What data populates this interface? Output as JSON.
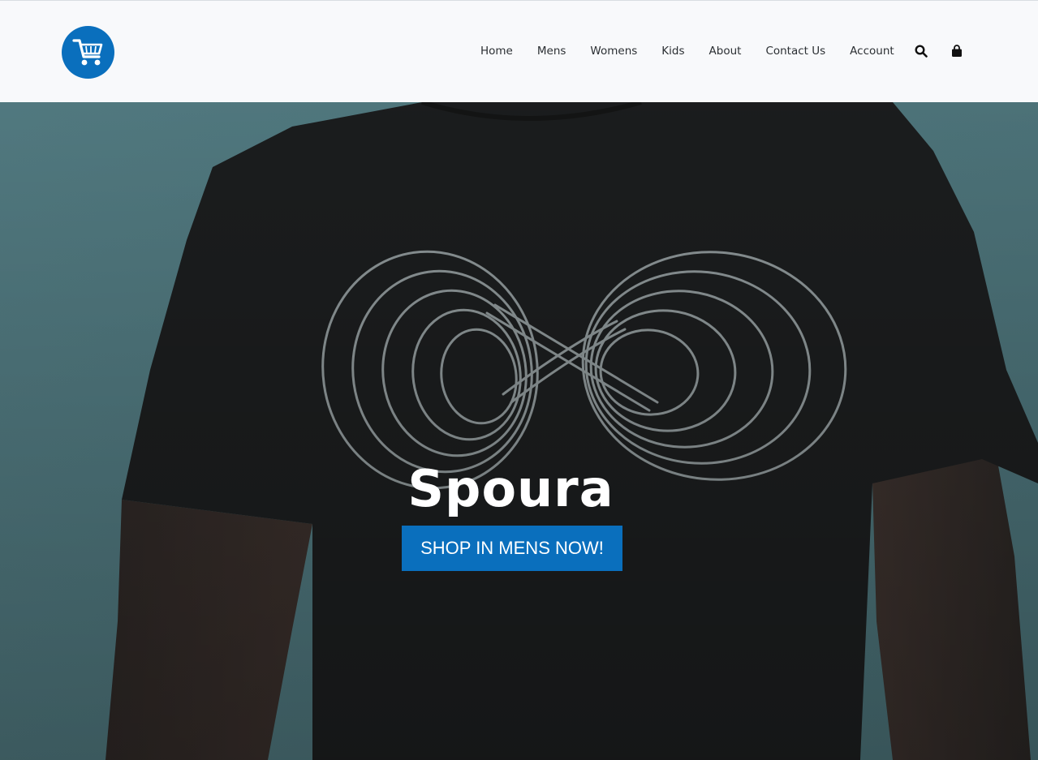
{
  "header": {
    "logo_icon": "shopping-cart-icon",
    "nav": [
      {
        "label": "Home"
      },
      {
        "label": "Mens"
      },
      {
        "label": "Womens"
      },
      {
        "label": "Kids"
      },
      {
        "label": "About"
      },
      {
        "label": "Contact Us"
      },
      {
        "label": "Account"
      }
    ],
    "search_icon": "search-icon",
    "bag_icon": "shopping-bag-icon"
  },
  "hero": {
    "title": "Spoura",
    "cta_label": "SHOP IN MENS NOW!",
    "image_description_icon": "tshirt-hero-image"
  },
  "colors": {
    "accent": "#0a6fbd",
    "header_bg": "#f8f9fb",
    "nav_text": "#2b2f33",
    "hero_bg": "#4f7a80",
    "shirt": "#1c1e1f"
  }
}
